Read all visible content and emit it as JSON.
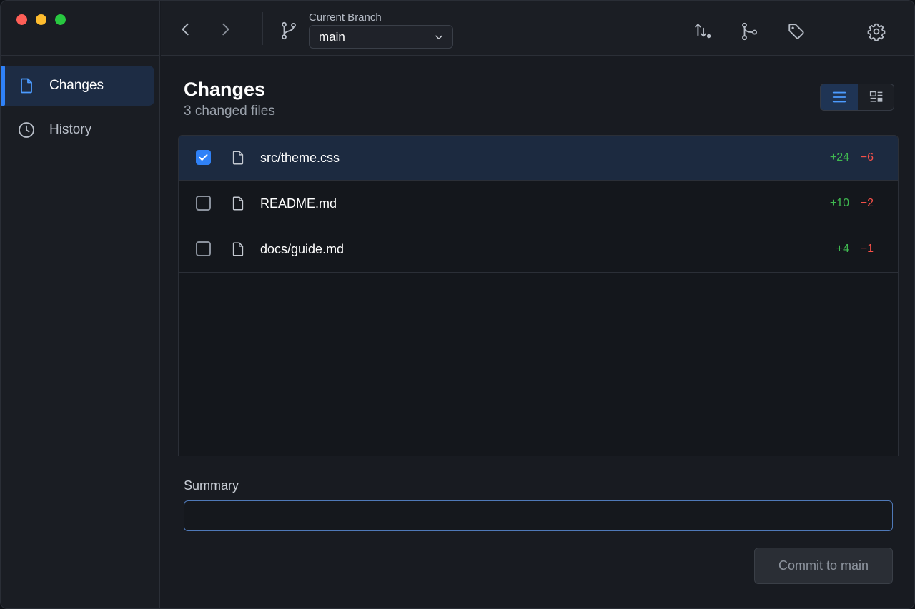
{
  "window": {
    "controls": [
      "close",
      "minimize",
      "zoom"
    ]
  },
  "sidebar": {
    "items": [
      {
        "label": "Changes",
        "icon": "file-icon",
        "active": true
      },
      {
        "label": "History",
        "icon": "clock-icon",
        "active": false
      }
    ]
  },
  "toolbar": {
    "back_icon": "chevron-left-icon",
    "forward_icon": "chevron-right-icon",
    "branch_icon": "git-branch-icon",
    "branch_caption": "Current Branch",
    "branch_value": "main",
    "actions": [
      "pull-request-icon",
      "merge-icon",
      "tag-icon",
      "gear-icon"
    ]
  },
  "main": {
    "title": "Changes",
    "subtitle": "3 changed files",
    "view_modes": [
      "list-icon",
      "split-icon"
    ],
    "files": [
      {
        "name": "src/theme.css",
        "additions": "+24",
        "deletions": "−6",
        "checked": true
      },
      {
        "name": "README.md",
        "additions": "+10",
        "deletions": "−2",
        "checked": false
      },
      {
        "name": "docs/guide.md",
        "additions": "+4",
        "deletions": "−1",
        "checked": false
      }
    ],
    "summary_label": "Summary",
    "summary_value": "",
    "commit_label": "Commit to main"
  },
  "colors": {
    "accent": "#2f81f7",
    "additions": "#3fb950",
    "deletions": "#f85149"
  }
}
